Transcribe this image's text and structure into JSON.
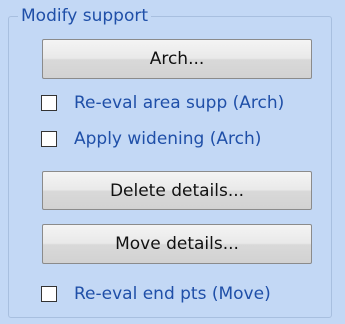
{
  "group": {
    "title": "Modify support"
  },
  "buttons": {
    "arch": "Arch...",
    "delete_details": "Delete details...",
    "move_details": "Move details..."
  },
  "checkboxes": [
    {
      "label": "Re-eval area supp (Arch)",
      "checked": false
    },
    {
      "label": "Apply widening (Arch)",
      "checked": false
    },
    {
      "label": "Re-eval end pts (Move)",
      "checked": false
    }
  ],
  "colors": {
    "panel_background": "#c3d8f5",
    "label_text": "#1f4fa8",
    "button_text": "#111111"
  }
}
